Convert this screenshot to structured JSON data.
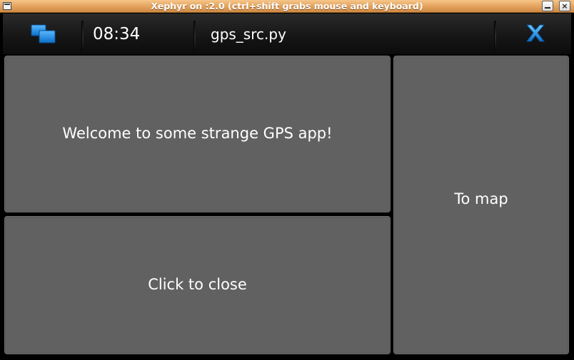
{
  "host_window": {
    "title": "Xephyr on :2.0 (ctrl+shift grabs mouse and keyboard)",
    "menu_icon": "window-menu-icon",
    "minimize_icon": "minimize-icon",
    "close_label": "×"
  },
  "status_bar": {
    "task_switcher_icon": "task-switcher-icon",
    "clock": "08:34",
    "app_title": "gps_src.py",
    "close_icon": "close-icon",
    "accent_color": "#1e8fe0"
  },
  "main": {
    "welcome_text": "Welcome to some strange GPS app!",
    "close_button_label": "Click to close",
    "map_button_label": "To map"
  }
}
